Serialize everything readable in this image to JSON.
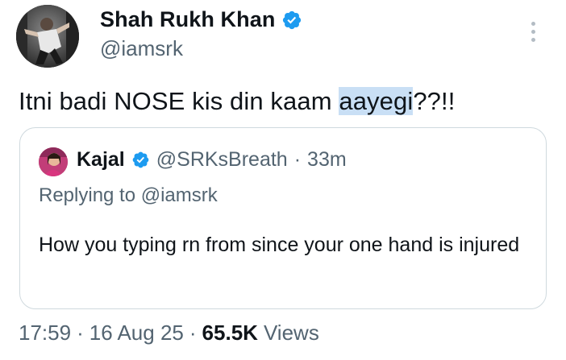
{
  "author": {
    "display_name": "Shah Rukh Khan",
    "handle": "@iamsrk",
    "verified_icon": "verified-badge-icon"
  },
  "tweet": {
    "text_before": "Itni badi NOSE kis din kaam ",
    "text_highlighted": "aayegi",
    "text_after": "??!!"
  },
  "quoted_tweet": {
    "display_name": "Kajal",
    "handle": "@SRKsBreath",
    "separator": "·",
    "time": "33m",
    "replying_to": "Replying to @iamsrk",
    "text": "How you typing rn from since your one hand is injured"
  },
  "meta": {
    "time": "17:59",
    "separator": "·",
    "date": "16 Aug 25",
    "views_count": "65.5K",
    "views_label": "Views"
  },
  "colors": {
    "verified_blue": "#1d9bf0",
    "secondary_text": "#536471",
    "highlight": "#c9dff5",
    "border": "#cfd9de"
  }
}
